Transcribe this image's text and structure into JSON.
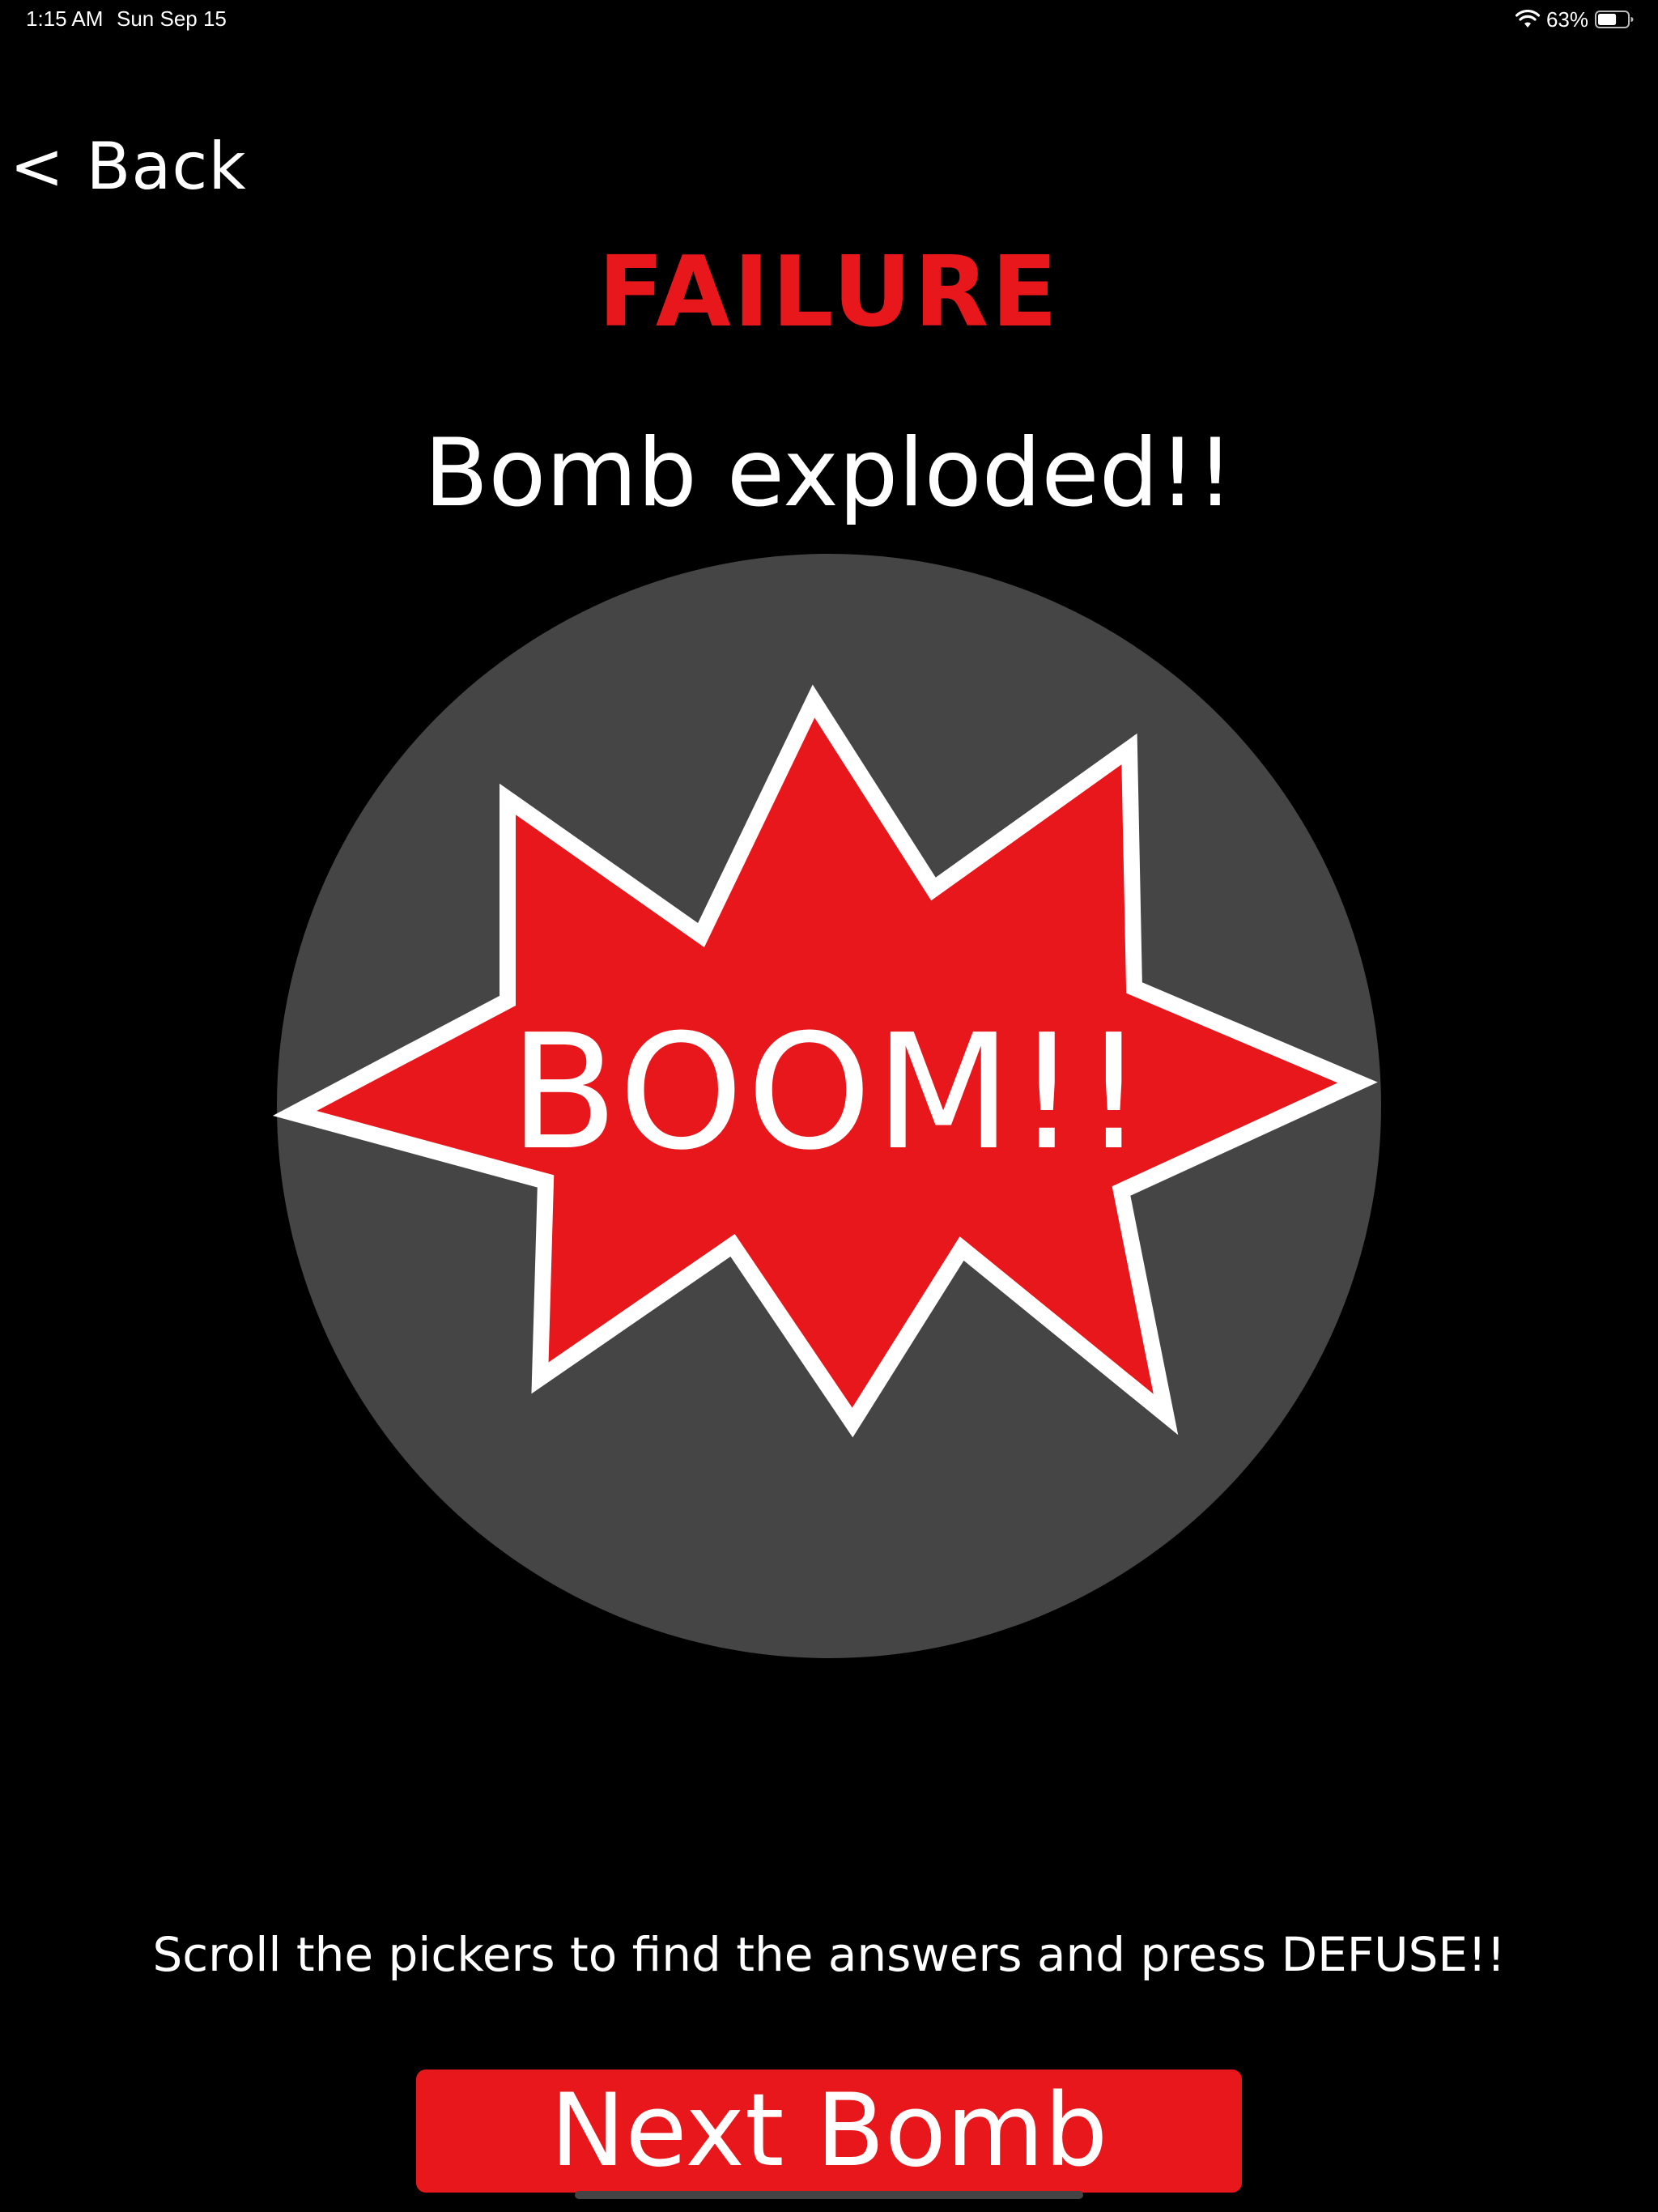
{
  "status_bar": {
    "time": "1:15 AM",
    "date": "Sun Sep 15",
    "battery_percent": "63%",
    "battery_level": 0.63
  },
  "nav": {
    "back_label": "< Back"
  },
  "result": {
    "title": "FAILURE",
    "message": "Bomb exploded!!",
    "boom_label": "BOOM!!"
  },
  "instructions": "Scroll the pickers to find the answers and press DEFUSE!!",
  "next_button_label": "Next Bomb",
  "colors": {
    "accent_red": "#e8171b",
    "background": "#000000",
    "circle_gray": "#454545",
    "text": "#ffffff"
  },
  "icons": [
    "wifi-icon",
    "battery-icon",
    "explosion-burst-icon"
  ]
}
